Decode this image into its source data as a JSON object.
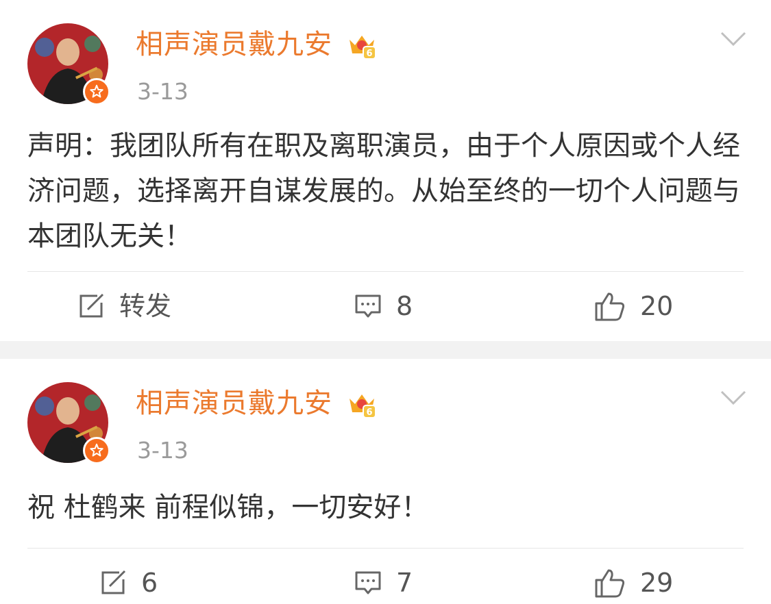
{
  "posts": [
    {
      "author": "相声演员戴九安",
      "date": "3-13",
      "content": "声明：我团队所有在职及离职演员，由于个人原因或个人经济问题，选择离开自谋发展的。从始至终的一切个人问题与本团队无关！",
      "repost": "转发",
      "comments": "8",
      "likes": "20"
    },
    {
      "author": "相声演员戴九安",
      "date": "3-13",
      "content": "祝 杜鹤来 前程似锦，一切安好！",
      "repost": "6",
      "comments": "7",
      "likes": "29"
    }
  ],
  "icons": {
    "verified": "verified-badge-icon",
    "member": "crown-member-icon",
    "menu": "chevron-down-icon",
    "repost": "repost-icon",
    "comment": "comment-icon",
    "like": "thumbs-up-icon"
  },
  "colors": {
    "author_name": "#eb7a2e",
    "verified_badge": "#f76c1d",
    "crown": "#f5a623",
    "separator": "#f2f2f2"
  }
}
